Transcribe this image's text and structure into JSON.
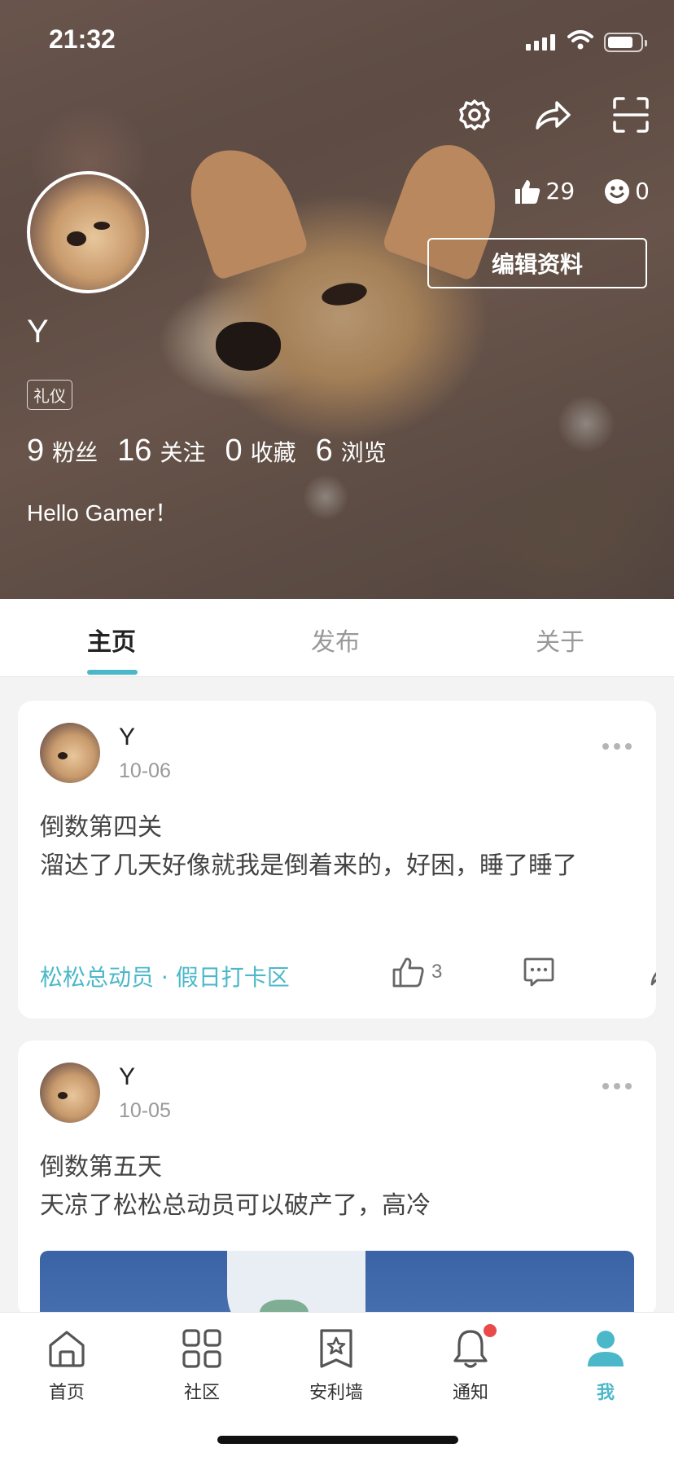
{
  "status_bar": {
    "time": "21:32"
  },
  "profile": {
    "username": "Y",
    "tag": "礼仪",
    "likes_count": "29",
    "smile_count": "0",
    "edit_button_label": "编辑资料",
    "stats": [
      {
        "num": "9",
        "label": "粉丝"
      },
      {
        "num": "16",
        "label": "关注"
      },
      {
        "num": "0",
        "label": "收藏"
      },
      {
        "num": "6",
        "label": "浏览"
      }
    ],
    "bio": "Hello Gamer！"
  },
  "top_actions": {
    "icons": [
      "gear-icon",
      "share-icon",
      "scan-icon"
    ]
  },
  "tabs": [
    {
      "label": "主页",
      "active": true
    },
    {
      "label": "发布",
      "active": false
    },
    {
      "label": "关于",
      "active": false
    }
  ],
  "posts": [
    {
      "author": "Y",
      "date": "10-06",
      "title": "倒数第四关",
      "content": "溜达了几天好像就我是倒着来的，好困，睡了睡了",
      "topic": "松松总动员 · 假日打卡区",
      "like_count": "3"
    },
    {
      "author": "Y",
      "date": "10-05",
      "title": "倒数第五天",
      "content": "天凉了松松总动员可以破产了，高冷"
    }
  ],
  "bottom_nav": [
    {
      "label": "首页",
      "icon": "home-icon"
    },
    {
      "label": "社区",
      "icon": "grid-icon"
    },
    {
      "label": "安利墙",
      "icon": "star-bookmark-icon"
    },
    {
      "label": "通知",
      "icon": "bell-icon",
      "badge": true
    },
    {
      "label": "我",
      "icon": "user-icon",
      "active": true
    }
  ],
  "colors": {
    "accent": "#4bb8c9",
    "badge": "#e94b4b"
  }
}
